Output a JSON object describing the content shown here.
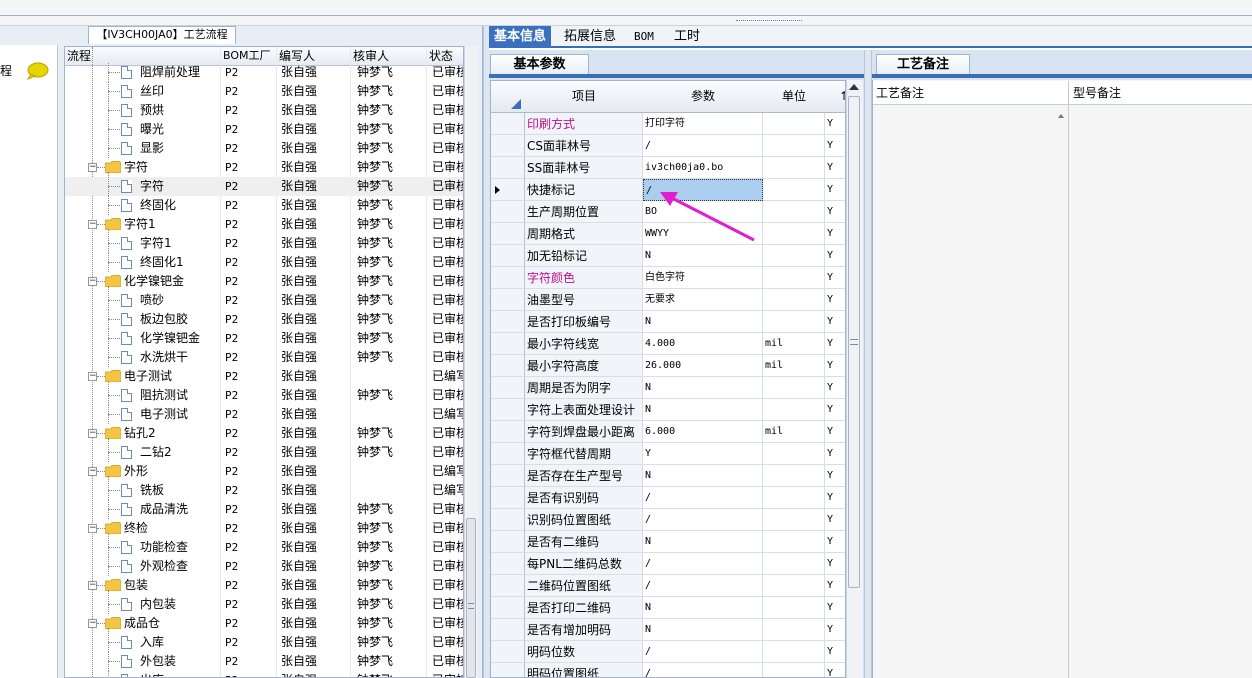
{
  "left_panel": {
    "tab_title": "【IV3CH00JA0】工艺流程",
    "strip_label": "程",
    "columns": [
      "流程",
      "BOM工厂",
      "编写人",
      "核审人",
      "状态"
    ],
    "rows": [
      {
        "name": "阻焊前处理",
        "level": 2,
        "bom": "P2",
        "writer": "张自强",
        "reviewer": "钟梦飞",
        "status": "已审核"
      },
      {
        "name": "丝印",
        "level": 2,
        "bom": "P2",
        "writer": "张自强",
        "reviewer": "钟梦飞",
        "status": "已审核"
      },
      {
        "name": "预烘",
        "level": 2,
        "bom": "P2",
        "writer": "张自强",
        "reviewer": "钟梦飞",
        "status": "已审核"
      },
      {
        "name": "曝光",
        "level": 2,
        "bom": "P2",
        "writer": "张自强",
        "reviewer": "钟梦飞",
        "status": "已审核"
      },
      {
        "name": "显影",
        "level": 2,
        "bom": "P2",
        "writer": "张自强",
        "reviewer": "钟梦飞",
        "status": "已审核"
      },
      {
        "name": "字符",
        "level": 1,
        "bom": "P2",
        "writer": "张自强",
        "reviewer": "钟梦飞",
        "status": "已审核"
      },
      {
        "name": "字符",
        "level": 2,
        "bom": "P2",
        "writer": "张自强",
        "reviewer": "钟梦飞",
        "status": "已审核",
        "selected": true
      },
      {
        "name": "终固化",
        "level": 2,
        "bom": "P2",
        "writer": "张自强",
        "reviewer": "钟梦飞",
        "status": "已审核"
      },
      {
        "name": "字符1",
        "level": 1,
        "bom": "P2",
        "writer": "张自强",
        "reviewer": "钟梦飞",
        "status": "已审核"
      },
      {
        "name": "字符1",
        "level": 2,
        "bom": "P2",
        "writer": "张自强",
        "reviewer": "钟梦飞",
        "status": "已审核"
      },
      {
        "name": "终固化1",
        "level": 2,
        "bom": "P2",
        "writer": "张自强",
        "reviewer": "钟梦飞",
        "status": "已审核"
      },
      {
        "name": "化学镍钯金",
        "level": 1,
        "bom": "P2",
        "writer": "张自强",
        "reviewer": "钟梦飞",
        "status": "已审核"
      },
      {
        "name": "喷砂",
        "level": 2,
        "bom": "P2",
        "writer": "张自强",
        "reviewer": "钟梦飞",
        "status": "已审核"
      },
      {
        "name": "板边包胶",
        "level": 2,
        "bom": "P2",
        "writer": "张自强",
        "reviewer": "钟梦飞",
        "status": "已审核"
      },
      {
        "name": "化学镍钯金",
        "level": 2,
        "bom": "P2",
        "writer": "张自强",
        "reviewer": "钟梦飞",
        "status": "已审核"
      },
      {
        "name": "水洗烘干",
        "level": 2,
        "bom": "P2",
        "writer": "张自强",
        "reviewer": "钟梦飞",
        "status": "已审核"
      },
      {
        "name": "电子测试",
        "level": 1,
        "bom": "P2",
        "writer": "张自强",
        "reviewer": "",
        "status": "已编写"
      },
      {
        "name": "阻抗测试",
        "level": 2,
        "bom": "P2",
        "writer": "张自强",
        "reviewer": "钟梦飞",
        "status": "已审核"
      },
      {
        "name": "电子测试",
        "level": 2,
        "bom": "P2",
        "writer": "张自强",
        "reviewer": "",
        "status": "已编写"
      },
      {
        "name": "钻孔2",
        "level": 1,
        "bom": "P2",
        "writer": "张自强",
        "reviewer": "钟梦飞",
        "status": "已审核"
      },
      {
        "name": "二钻2",
        "level": 2,
        "bom": "P2",
        "writer": "张自强",
        "reviewer": "钟梦飞",
        "status": "已审核"
      },
      {
        "name": "外形",
        "level": 1,
        "bom": "P2",
        "writer": "张自强",
        "reviewer": "",
        "status": "已编写"
      },
      {
        "name": "铣板",
        "level": 2,
        "bom": "P2",
        "writer": "张自强",
        "reviewer": "",
        "status": "已编写"
      },
      {
        "name": "成品清洗",
        "level": 2,
        "bom": "P2",
        "writer": "张自强",
        "reviewer": "钟梦飞",
        "status": "已审核"
      },
      {
        "name": "终检",
        "level": 1,
        "bom": "P2",
        "writer": "张自强",
        "reviewer": "钟梦飞",
        "status": "已审核"
      },
      {
        "name": "功能检查",
        "level": 2,
        "bom": "P2",
        "writer": "张自强",
        "reviewer": "钟梦飞",
        "status": "已审核"
      },
      {
        "name": "外观检查",
        "level": 2,
        "bom": "P2",
        "writer": "张自强",
        "reviewer": "钟梦飞",
        "status": "已审核"
      },
      {
        "name": "包装",
        "level": 1,
        "bom": "P2",
        "writer": "张自强",
        "reviewer": "钟梦飞",
        "status": "已审核"
      },
      {
        "name": "内包装",
        "level": 2,
        "bom": "P2",
        "writer": "张自强",
        "reviewer": "钟梦飞",
        "status": "已审核"
      },
      {
        "name": "成品仓",
        "level": 1,
        "bom": "P2",
        "writer": "张自强",
        "reviewer": "钟梦飞",
        "status": "已审核"
      },
      {
        "name": "入库",
        "level": 2,
        "bom": "P2",
        "writer": "张自强",
        "reviewer": "钟梦飞",
        "status": "已审核"
      },
      {
        "name": "外包装",
        "level": 2,
        "bom": "P2",
        "writer": "张自强",
        "reviewer": "钟梦飞",
        "status": "已审核"
      },
      {
        "name": "出库",
        "level": 2,
        "bom": "P2",
        "writer": "张自强",
        "reviewer": "钟梦飞",
        "status": "已审核"
      }
    ]
  },
  "main_tabs": [
    {
      "label": "基本信息",
      "active": true
    },
    {
      "label": "拓展信息",
      "active": false
    },
    {
      "label": "BOM",
      "active": false
    },
    {
      "label": "工时",
      "active": false
    }
  ],
  "params_panel": {
    "subtab": "基本参数",
    "columns": [
      "项目",
      "参数",
      "单位",
      "↑"
    ],
    "rows": [
      {
        "item": "印刷方式",
        "param": "打印字符",
        "unit": "",
        "flag": "Y",
        "highlight": true
      },
      {
        "item": "CS面菲林号",
        "param": "/",
        "unit": "",
        "flag": "Y"
      },
      {
        "item": "SS面菲林号",
        "param": "iv3ch00ja0.bo",
        "unit": "",
        "flag": "Y"
      },
      {
        "item": "快捷标记",
        "param": "/",
        "unit": "",
        "flag": "Y",
        "current": true
      },
      {
        "item": "生产周期位置",
        "param": "BO",
        "unit": "",
        "flag": "Y"
      },
      {
        "item": "周期格式",
        "param": "WWYY",
        "unit": "",
        "flag": "Y"
      },
      {
        "item": "加无铅标记",
        "param": "N",
        "unit": "",
        "flag": "Y"
      },
      {
        "item": "字符颜色",
        "param": "白色字符",
        "unit": "",
        "flag": "Y",
        "highlight": true
      },
      {
        "item": "油墨型号",
        "param": "无要求",
        "unit": "",
        "flag": "Y"
      },
      {
        "item": "是否打印板编号",
        "param": "N",
        "unit": "",
        "flag": "Y"
      },
      {
        "item": "最小字符线宽",
        "param": "4.000",
        "unit": "mil",
        "flag": "Y"
      },
      {
        "item": "最小字符高度",
        "param": "26.000",
        "unit": "mil",
        "flag": "Y"
      },
      {
        "item": "周期是否为阴字",
        "param": "N",
        "unit": "",
        "flag": "Y"
      },
      {
        "item": "字符上表面处理设计",
        "param": "N",
        "unit": "",
        "flag": "Y"
      },
      {
        "item": "字符到焊盘最小距离",
        "param": "6.000",
        "unit": "mil",
        "flag": "Y"
      },
      {
        "item": "字符框代替周期",
        "param": "Y",
        "unit": "",
        "flag": "Y"
      },
      {
        "item": "是否存在生产型号",
        "param": "N",
        "unit": "",
        "flag": "Y"
      },
      {
        "item": "是否有识别码",
        "param": "/",
        "unit": "",
        "flag": "Y"
      },
      {
        "item": "识别码位置图纸",
        "param": "/",
        "unit": "",
        "flag": "Y"
      },
      {
        "item": "是否有二维码",
        "param": "N",
        "unit": "",
        "flag": "Y"
      },
      {
        "item": "每PNL二维码总数",
        "param": "/",
        "unit": "",
        "flag": "Y"
      },
      {
        "item": "二维码位置图纸",
        "param": "/",
        "unit": "",
        "flag": "Y"
      },
      {
        "item": "是否打印二维码",
        "param": "N",
        "unit": "",
        "flag": "Y"
      },
      {
        "item": "是否有增加明码",
        "param": "N",
        "unit": "",
        "flag": "Y"
      },
      {
        "item": "明码位数",
        "param": "/",
        "unit": "",
        "flag": "Y"
      },
      {
        "item": "明码位置图纸",
        "param": "/",
        "unit": "",
        "flag": "Y"
      }
    ]
  },
  "remarks_panel": {
    "subtab": "工艺备注",
    "columns": [
      "工艺备注",
      "型号备注"
    ]
  },
  "colors": {
    "accent": "#3a70bf",
    "highlight_text": "#c0108c",
    "selected_cell": "#aacdf0",
    "arrow": "#e020d0"
  },
  "icons": [
    "chat-bubble-icon",
    "folder-icon",
    "document-icon",
    "expand-minus-icon",
    "row-pointer-icon"
  ]
}
